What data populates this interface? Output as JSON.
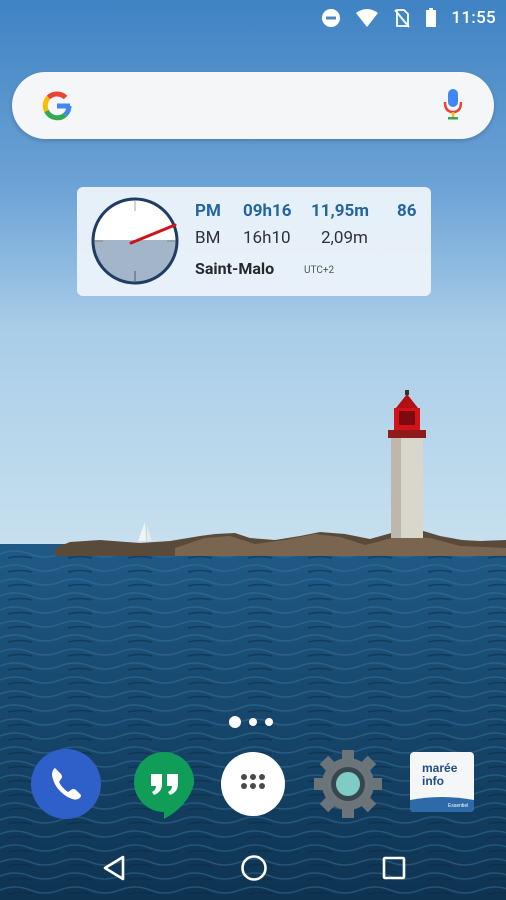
{
  "status_bar": {
    "time": "11:55",
    "icons": [
      "do-not-disturb-icon",
      "wifi-icon",
      "no-sim-icon",
      "battery-icon"
    ]
  },
  "search_bar": {
    "logo": "google-g-icon",
    "mic": "mic-icon"
  },
  "tide_widget": {
    "high_tide": {
      "label": "PM",
      "time": "09h16",
      "height": "11,95m",
      "coefficient": "86"
    },
    "low_tide": {
      "label": "BM",
      "time": "16h10",
      "height": "2,09m"
    },
    "port": "Saint-Malo",
    "timezone": "UTC+2",
    "colors": {
      "accent": "#2364a5",
      "needle": "#d0121b",
      "water": "#a3b6c9"
    }
  },
  "page_indicator": {
    "pages": 3,
    "current": 1
  },
  "dock": {
    "apps": [
      {
        "name": "Phone",
        "icon": "phone-icon"
      },
      {
        "name": "Hangouts",
        "icon": "hangouts-icon"
      },
      {
        "name": "All apps",
        "icon": "app-drawer-icon"
      },
      {
        "name": "Settings",
        "icon": "settings-gear-icon"
      },
      {
        "name": "Marée Info",
        "icon": "maree-info-icon",
        "icon_text": [
          "marée",
          "info"
        ],
        "badge": "Essentiel"
      }
    ]
  },
  "nav_bar": {
    "buttons": [
      "back-icon",
      "home-icon",
      "recents-icon"
    ]
  }
}
